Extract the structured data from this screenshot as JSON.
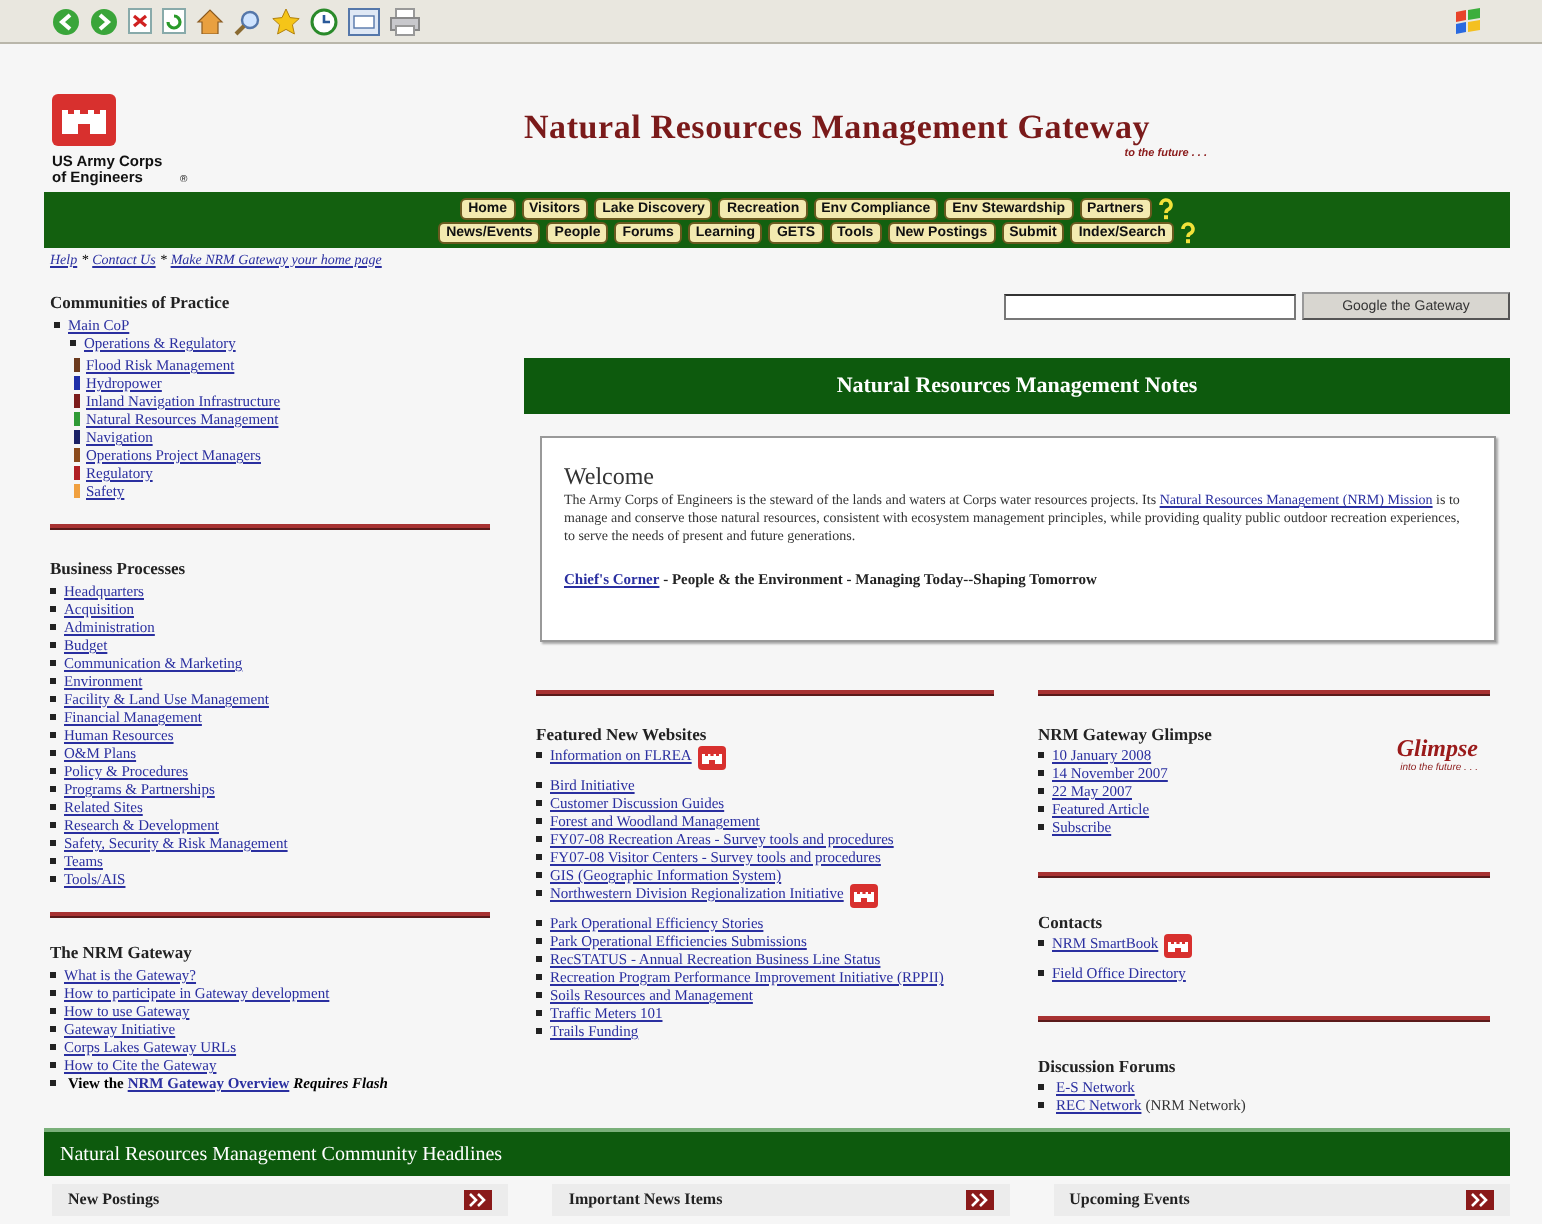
{
  "header": {
    "logo_text": "US Army Corps of Engineers",
    "logo_mark": "®",
    "title": "Natural Resources Management Gateway",
    "tagline": "to the future . . ."
  },
  "nav": {
    "top_row": [
      "Home",
      "Visitors",
      "Lake Discovery",
      "Recreation",
      "Env Compliance",
      "Env Stewardship",
      "Partners"
    ],
    "bottom_row": [
      "News/Events",
      "People",
      "Forums",
      "Learning",
      "GETS",
      "Tools",
      "New Postings",
      "Submit",
      "Index/Search"
    ]
  },
  "quick_links": {
    "separator": "*",
    "links": [
      "Help",
      "Contact Us",
      "Make NRM Gateway your home page"
    ]
  },
  "search": {
    "button": "Google the Gateway"
  },
  "communities": {
    "heading": "Communities of Practice",
    "items": [
      {
        "label": "Main CoP",
        "children": [
          {
            "label": "Operations & Regulatory",
            "children": [
              {
                "label": "Flood Risk Management",
                "color": "#6b3a1e"
              },
              {
                "label": "Hydropower",
                "color": "#1f2fa8"
              },
              {
                "label": "Inland Navigation Infrastructure",
                "color": "#7c1c1c"
              },
              {
                "label": "Natural Resources Management",
                "color": "#2f9a36"
              },
              {
                "label": "Navigation",
                "color": "#1b2266"
              },
              {
                "label": "Operations Project Managers",
                "color": "#8a4a1c"
              },
              {
                "label": "Regulatory",
                "color": "#b01f24"
              },
              {
                "label": "Safety",
                "color": "#f0a040"
              }
            ]
          }
        ]
      }
    ]
  },
  "business": {
    "heading": "Business Processes",
    "items": [
      "Headquarters",
      "Acquisition",
      "Administration",
      "Budget",
      "Communication & Marketing",
      "Environment",
      "Facility & Land Use Management",
      "Financial Management",
      "Human Resources",
      "O&M Plans",
      "Policy & Procedures",
      "Programs & Partnerships",
      "Related Sites",
      "Research & Development",
      "Safety, Security & Risk Management",
      "Teams",
      "Tools/AIS"
    ]
  },
  "gateway": {
    "heading": "The NRM Gateway",
    "items": [
      {
        "kind": "link",
        "label": "What is the Gateway?"
      },
      {
        "kind": "link",
        "label": "How to participate in Gateway development"
      },
      {
        "kind": "link",
        "label": "How to use Gateway"
      },
      {
        "kind": "link",
        "label": "Gateway Initiative"
      },
      {
        "kind": "link",
        "label": "Corps Lakes Gateway URLs"
      },
      {
        "kind": "link",
        "label": "How to Cite the Gateway"
      },
      {
        "kind": "flash",
        "prefix": "View the",
        "link": "NRM Gateway Overview",
        "note": "Requires Flash"
      }
    ]
  },
  "notes": {
    "title": "Natural Resources Management Notes",
    "welcome": {
      "heading": "Welcome",
      "text_before": "The Army Corps of Engineers is the steward of the lands and waters at Corps water resources projects. Its ",
      "link": "Natural Resources Management (NRM) Mission",
      "text_after": " is to manage and conserve those natural resources, consistent with ecosystem management principles, while providing quality public outdoor recreation experiences, to serve the needs of present and future generations."
    },
    "chief": {
      "link": "Chief's Corner",
      "text": " - People & the Environment - Managing Today--Shaping Tomorrow"
    }
  },
  "featured": {
    "heading": "Featured New Websites",
    "items": [
      {
        "label": "Information on FLREA",
        "badge": true
      },
      {
        "label": "Bird Initiative",
        "badge": false
      },
      {
        "label": "Customer Discussion Guides",
        "badge": false
      },
      {
        "label": "Forest and Woodland Management",
        "badge": false
      },
      {
        "label": "FY07-08 Recreation Areas - Survey tools and procedures",
        "badge": false
      },
      {
        "label": "FY07-08 Visitor Centers - Survey tools and procedures",
        "badge": false
      },
      {
        "label": "GIS (Geographic Information System)",
        "badge": false
      },
      {
        "label": "Northwestern Division Regionalization Initiative",
        "badge": true
      },
      {
        "label": "Park Operational Efficiency Stories",
        "badge": false
      },
      {
        "label": "Park Operational Efficiencies Submissions",
        "badge": false
      },
      {
        "label": "RecSTATUS - Annual Recreation Business Line Status",
        "badge": false
      },
      {
        "label": "Recreation Program Performance Improvement Initiative (RPPII)",
        "badge": false
      },
      {
        "label": "Soils Resources and Management",
        "badge": false
      },
      {
        "label": "Traffic Meters 101",
        "badge": false
      },
      {
        "label": "Trails Funding",
        "badge": false
      }
    ]
  },
  "glimpse": {
    "heading": "NRM Gateway Glimpse",
    "items": [
      "10 January 2008",
      "14 November 2007",
      "22 May 2007",
      "Featured Article",
      "Subscribe"
    ],
    "logo_word": "Glimpse",
    "logo_tagline": "into the future . . ."
  },
  "contacts": {
    "heading": "Contacts",
    "items": [
      {
        "label": "NRM SmartBook",
        "badge": true
      },
      {
        "label": "Field Office Directory",
        "badge": false
      }
    ]
  },
  "forums": {
    "heading": "Discussion Forums",
    "items": [
      {
        "label": "E-S Network"
      },
      {
        "label": "REC Network",
        "note": "(NRM Network)"
      }
    ]
  },
  "headlines": {
    "title": "Natural Resources Management Community Headlines",
    "panels": [
      "New Postings",
      "Important News Items",
      "Upcoming Events"
    ]
  }
}
